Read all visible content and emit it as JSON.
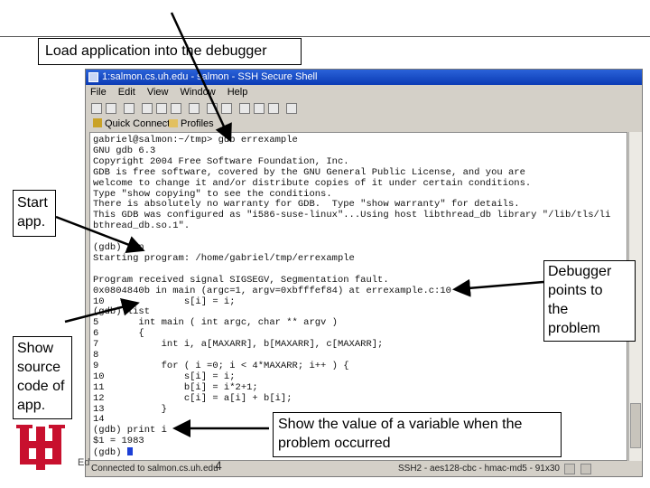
{
  "window": {
    "title": "1:salmon.cs.uh.edu - salmon - SSH Secure Shell",
    "menu": [
      "File",
      "Edit",
      "View",
      "Window",
      "Help"
    ],
    "quick_connect_label": "Quick Connect",
    "profiles_label": "Profiles"
  },
  "terminal_lines": [
    "gabriel@salmon:~/tmp> gdb errexample",
    "GNU gdb 6.3",
    "Copyright 2004 Free Software Foundation, Inc.",
    "GDB is free software, covered by the GNU General Public License, and you are",
    "welcome to change it and/or distribute copies of it under certain conditions.",
    "Type \"show copying\" to see the conditions.",
    "There is absolutely no warranty for GDB.  Type \"show warranty\" for details.",
    "This GDB was configured as \"i586-suse-linux\"...Using host libthread_db library \"/lib/tls/li",
    "bthread_db.so.1\".",
    "",
    "(gdb) run",
    "Starting program: /home/gabriel/tmp/errexample",
    "",
    "Program received signal SIGSEGV, Segmentation fault.",
    "0x0804840b in main (argc=1, argv=0xbfffef84) at errexample.c:10",
    "10              s[i] = i;",
    "(gdb) list",
    "5       int main ( int argc, char ** argv )",
    "6       {",
    "7           int i, a[MAXARR], b[MAXARR], c[MAXARR];",
    "8",
    "9           for ( i =0; i < 4*MAXARR; i++ ) {",
    "10              s[i] = i;",
    "11              b[i] = i*2+1;",
    "12              c[i] = a[i] + b[i];",
    "13          }",
    "14",
    "(gdb) print i",
    "$1 = 1983",
    "(gdb) "
  ],
  "status": {
    "left": "Connected to salmon.cs.uh.edu",
    "right": "SSH2 - aes128-cbc - hmac-md5 - 91x30"
  },
  "callouts": {
    "load": "Load application into the debugger",
    "start": [
      "Start",
      "app."
    ],
    "show_source": [
      "Show",
      "source",
      "code of",
      "app."
    ],
    "debugger": [
      "Debugger",
      "points to",
      "the",
      "problem"
    ],
    "variable": [
      "Show the value of a variable when the",
      "problem occurred"
    ]
  },
  "footer": {
    "left": "Ed",
    "page": "4"
  },
  "colors": {
    "logo_red": "#c8102e",
    "title_blue": "#0b3bb5",
    "cursor_blue": "#1c3fd6"
  }
}
